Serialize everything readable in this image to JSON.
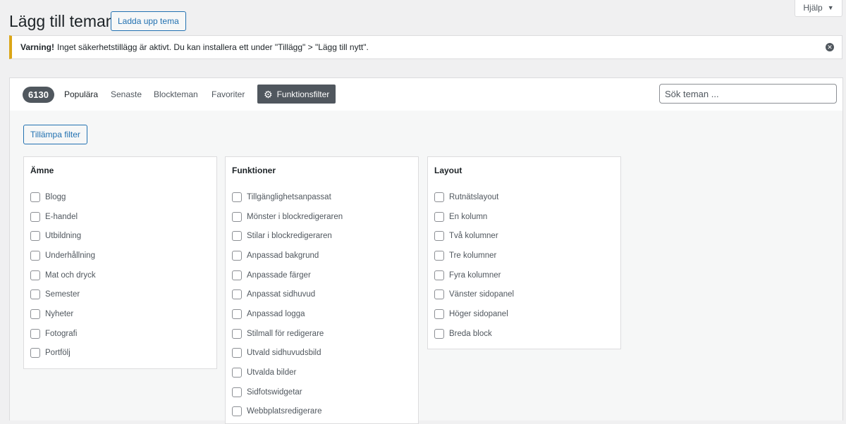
{
  "help": {
    "label": "Hjälp"
  },
  "page": {
    "title": "Lägg till teman",
    "upload_label": "Ladda upp tema"
  },
  "notice": {
    "strong": "Varning!",
    "text": "Inget säkerhetstillägg är aktivt. Du kan installera ett under \"Tillägg\" > \"Lägg till nytt\"."
  },
  "filters": {
    "count": "6130",
    "links": [
      "Populära",
      "Senaste",
      "Blockteman",
      "Favoriter"
    ],
    "feature_filter": "Funktionsfilter",
    "search_placeholder": "Sök teman ..."
  },
  "drawer": {
    "apply_label": "Tillämpa filter",
    "groups": [
      {
        "title": "Ämne",
        "items": [
          "Blogg",
          "E-handel",
          "Utbildning",
          "Underhållning",
          "Mat och dryck",
          "Semester",
          "Nyheter",
          "Fotografi",
          "Portfölj"
        ]
      },
      {
        "title": "Funktioner",
        "items": [
          "Tillgänglighetsanpassat",
          "Mönster i blockredigeraren",
          "Stilar i blockredigeraren",
          "Anpassad bakgrund",
          "Anpassade färger",
          "Anpassat sidhuvud",
          "Anpassad logga",
          "Stilmall för redigerare",
          "Utvald sidhuvudsbild",
          "Utvalda bilder",
          "Sidfotswidgetar",
          "Webbplatsredigerare"
        ]
      },
      {
        "title": "Layout",
        "items": [
          "Rutnätslayout",
          "En kolumn",
          "Två kolumner",
          "Tre kolumner",
          "Fyra kolumner",
          "Vänster sidopanel",
          "Höger sidopanel",
          "Breda block"
        ]
      }
    ]
  },
  "colors": {
    "accent": "#2271b1",
    "warning": "#dba617",
    "dark": "#50575e"
  }
}
